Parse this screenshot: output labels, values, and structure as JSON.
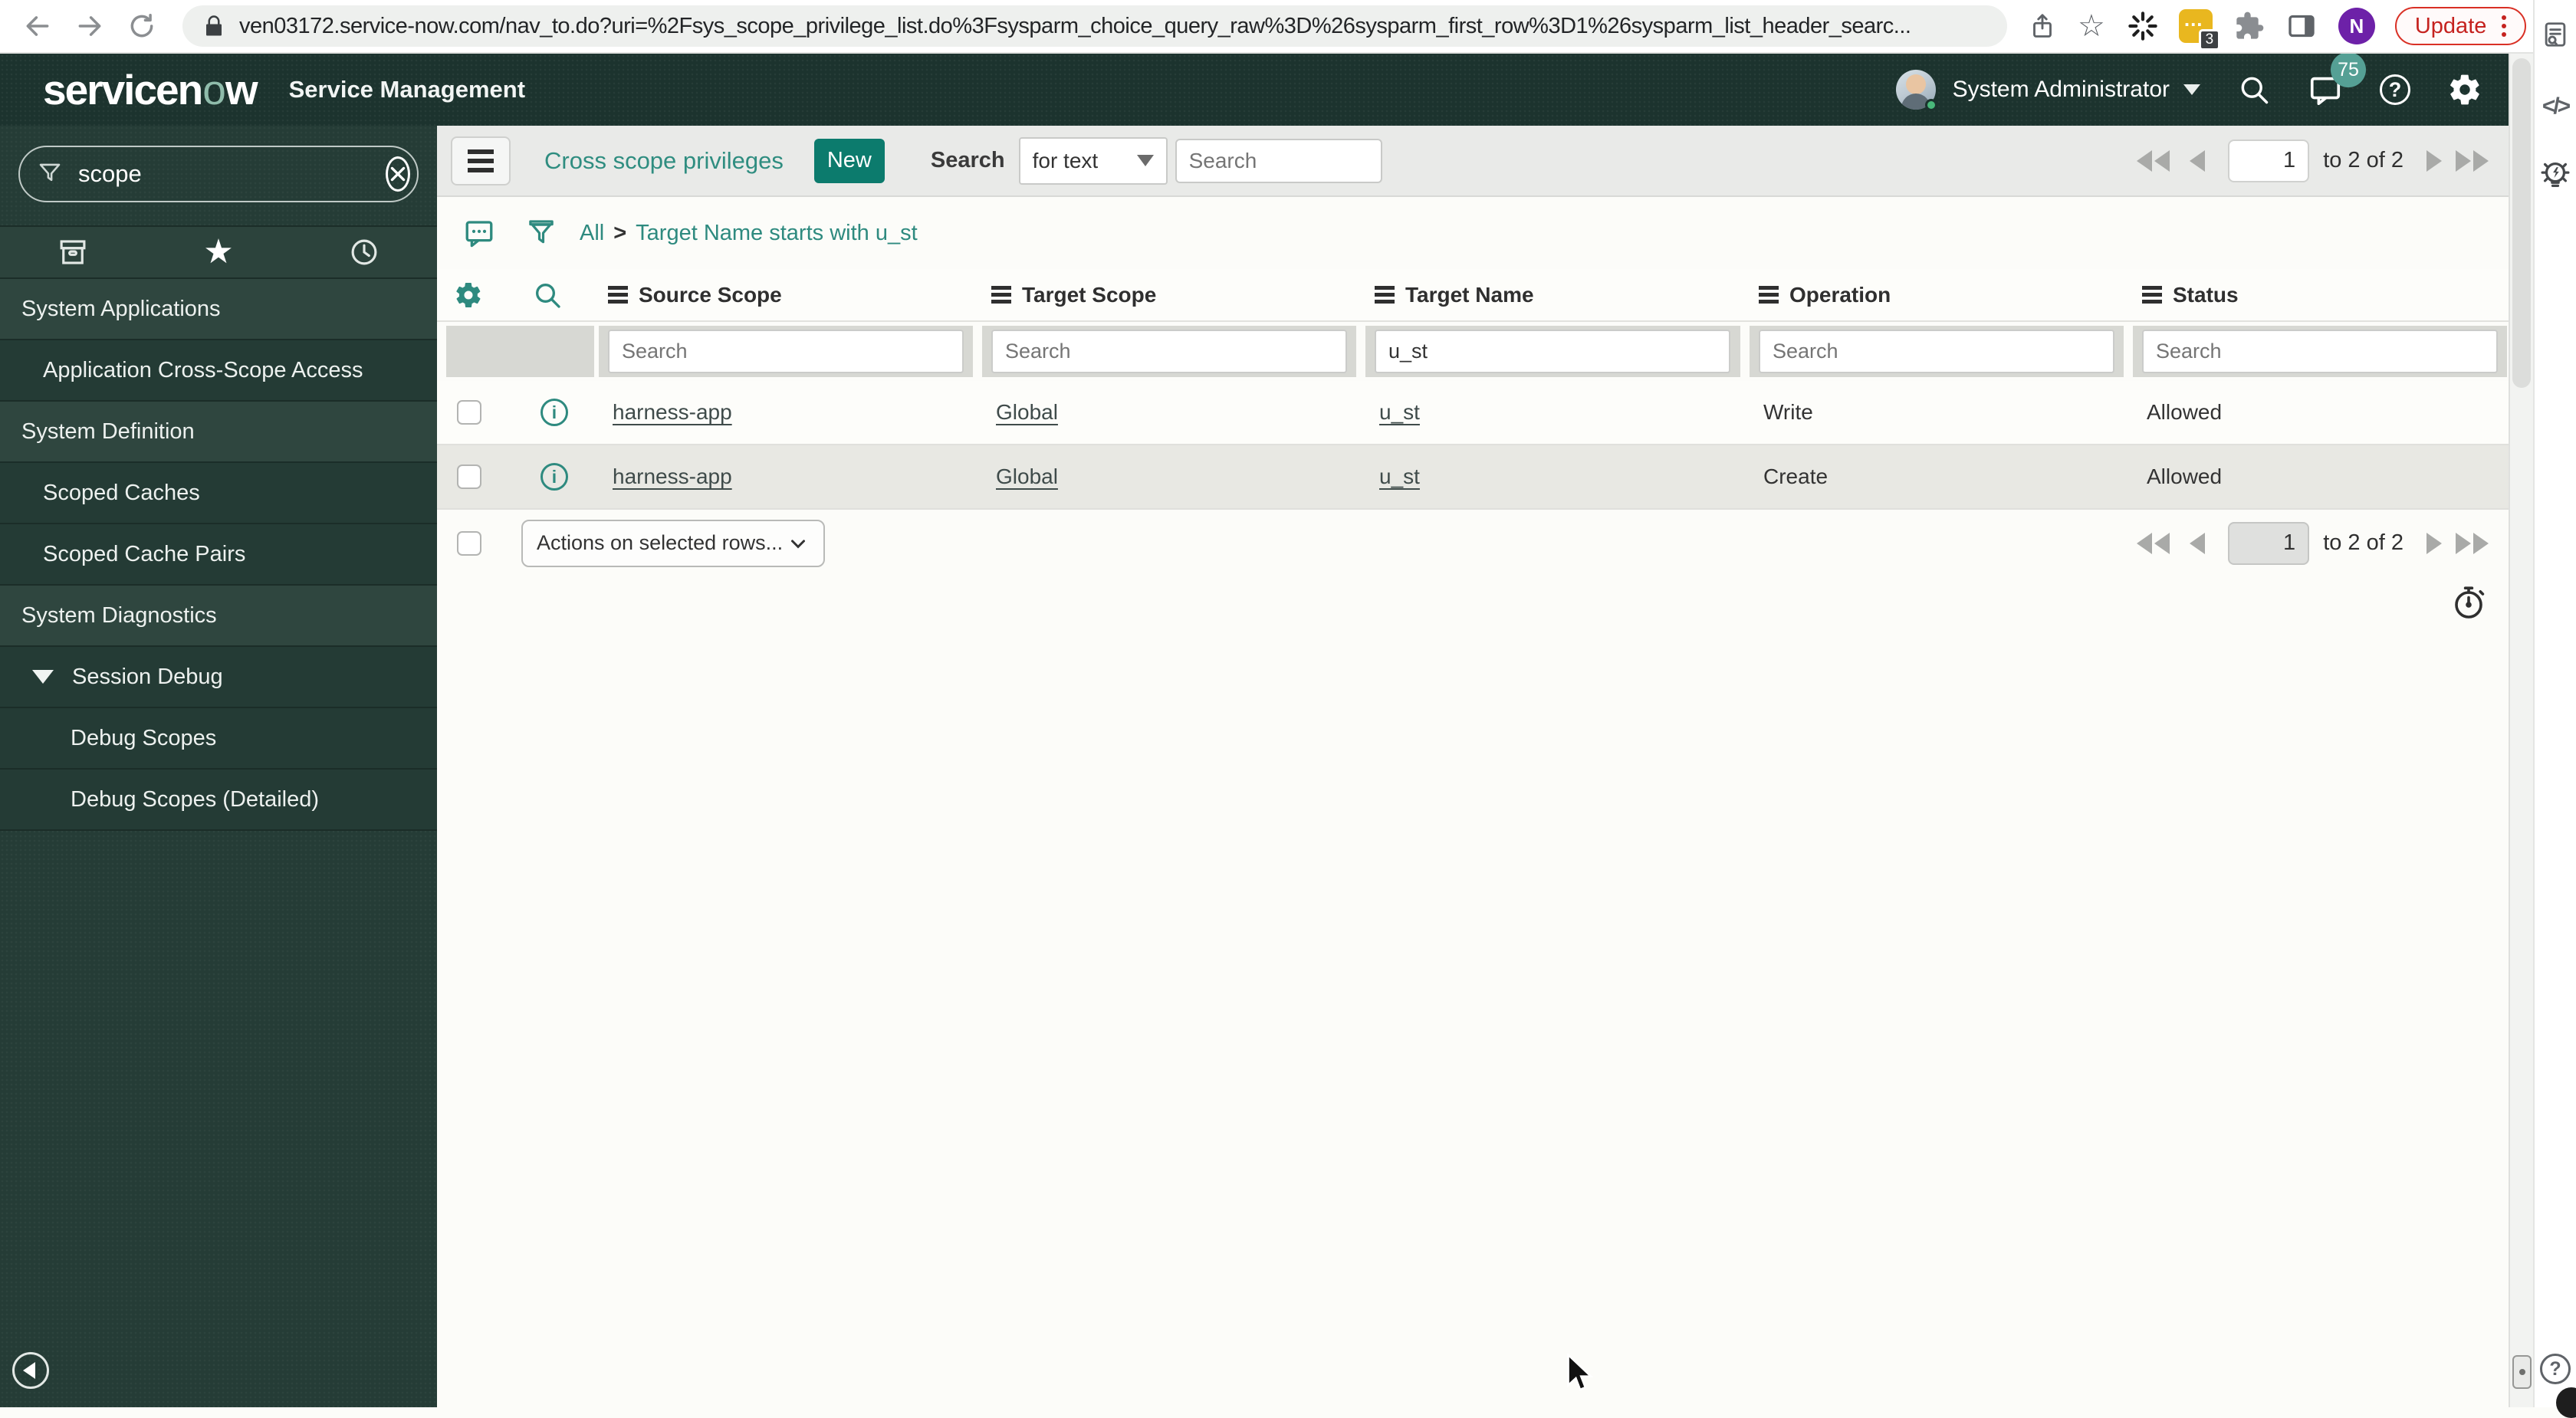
{
  "browser": {
    "url": "ven03172.service-now.com/nav_to.do?uri=%2Fsys_scope_privilege_list.do%3Fsysparm_choice_query_raw%3D%26sysparm_first_row%3D1%26sysparm_list_header_searc...",
    "update_label": "Update",
    "extension_badge": "3",
    "profile_initial": "N"
  },
  "header": {
    "logo_pre": "servicen",
    "logo_o": "o",
    "logo_post": "w",
    "product": "Service Management",
    "user": "System Administrator",
    "notifications_count": "75"
  },
  "icons": {
    "info_glyph": "i",
    "help_glyph": "?",
    "code_glyph": "</>",
    "star_glyph": "☆",
    "fav_star_glyph": "★",
    "ext_dots": "..."
  },
  "sidebar": {
    "filter_value": "scope",
    "items": [
      {
        "label": "System Applications",
        "type": "section"
      },
      {
        "label": "Application Cross-Scope Access",
        "type": "module"
      },
      {
        "label": "System Definition",
        "type": "section"
      },
      {
        "label": "Scoped Caches",
        "type": "module"
      },
      {
        "label": "Scoped Cache Pairs",
        "type": "module"
      },
      {
        "label": "System Diagnostics",
        "type": "section"
      },
      {
        "label": "Session Debug",
        "type": "module-expanded"
      },
      {
        "label": "Debug Scopes",
        "type": "submodule"
      },
      {
        "label": "Debug Scopes (Detailed)",
        "type": "submodule"
      }
    ]
  },
  "list": {
    "title": "Cross scope privileges",
    "new_label": "New",
    "search_label": "Search",
    "search_type": "for text",
    "search_placeholder": "Search",
    "breadcrumb": {
      "root": "All",
      "separator": ">",
      "condition": "Target Name starts with u_st"
    },
    "pagination": {
      "page": "1",
      "range_text": "to 2 of 2"
    },
    "columns": [
      "Source Scope",
      "Target Scope",
      "Target Name",
      "Operation",
      "Status"
    ],
    "filter_placeholder": "Search",
    "filters": {
      "target_name": "u_st"
    },
    "rows": [
      {
        "source_scope": "harness-app",
        "target_scope": "Global",
        "target_name": "u_st",
        "operation": "Write",
        "status": "Allowed"
      },
      {
        "source_scope": "harness-app",
        "target_scope": "Global",
        "target_name": "u_st",
        "operation": "Create",
        "status": "Allowed"
      }
    ],
    "actions_label": "Actions on selected rows..."
  },
  "colors": {
    "header_bg": "#1c332e",
    "sidebar_bg": "#253c36",
    "accent_teal": "#0c7b6d",
    "link_teal": "#2e8a7f",
    "badge_teal": "#55a095",
    "update_red": "#c5221f"
  }
}
